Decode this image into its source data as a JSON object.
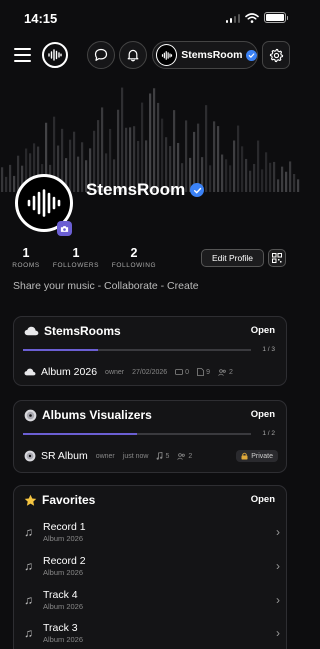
{
  "status_bar": {
    "time": "14:15"
  },
  "header": {
    "username": "StemsRoom"
  },
  "profile": {
    "name": "StemsRoom",
    "stats": [
      {
        "value": "1",
        "label": "ROOMS"
      },
      {
        "value": "1",
        "label": "FOLLOWERS"
      },
      {
        "value": "2",
        "label": "FOLLOWING"
      }
    ],
    "edit_label": "Edit Profile",
    "tagline": "Share your music - Collaborate - Create"
  },
  "stemsrooms": {
    "title": "StemsRooms",
    "open_label": "Open",
    "page": "1 / 3",
    "progress": 0.33,
    "item": {
      "title": "Album 2026",
      "role": "owner",
      "date": "27/02/2026",
      "messages": "0",
      "files": "9",
      "members": "2"
    }
  },
  "visualizers": {
    "title": "Albums Visualizers",
    "open_label": "Open",
    "page": "1 / 2",
    "progress": 0.5,
    "item": {
      "title": "SR Album",
      "role": "owner",
      "date": "just now",
      "tracks": "5",
      "members": "2",
      "badge": "Private"
    }
  },
  "favorites": {
    "title": "Favorites",
    "open_label": "Open",
    "items": [
      {
        "title": "Record 1",
        "subtitle": "Album 2026"
      },
      {
        "title": "Record 2",
        "subtitle": "Album 2026"
      },
      {
        "title": "Track 4",
        "subtitle": "Album 2026"
      },
      {
        "title": "Track 3",
        "subtitle": "Album 2026"
      }
    ]
  },
  "colors": {
    "accent": "#6b5fd3",
    "verified": "#3b82f6",
    "background": "#0d0d0f"
  }
}
